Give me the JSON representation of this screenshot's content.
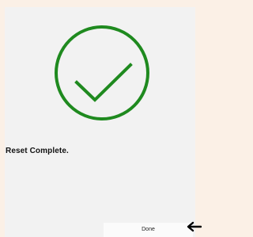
{
  "dialog": {
    "status_icon": "checkmark-circle-icon",
    "message": "Reset Complete.",
    "done_label": "Done"
  },
  "cursor": {
    "icon": "arrow-left-pointer-icon"
  },
  "colors": {
    "success_green": "#1f8a1f",
    "panel_background": "#f2f2f2",
    "window_background": "#fbf0e6"
  }
}
